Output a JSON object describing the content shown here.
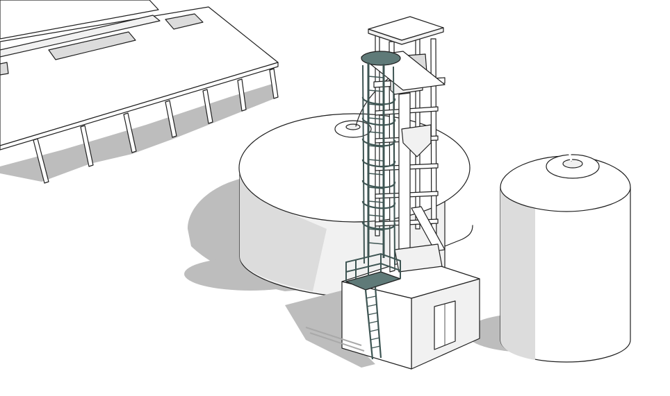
{
  "scene": {
    "colors": {
      "background": "#ffffff",
      "outline": "#1f1f1f",
      "shadow": "#bdbdbd",
      "wall_shade": "#dcdcdc",
      "ladder_steel": "#5f7a78"
    },
    "objects": [
      "machine-shed",
      "storage-bin",
      "bucket-elevator-tower",
      "caged-ladder",
      "landing-platform",
      "base-building",
      "hopper-silo",
      "transfer-pipe"
    ]
  }
}
